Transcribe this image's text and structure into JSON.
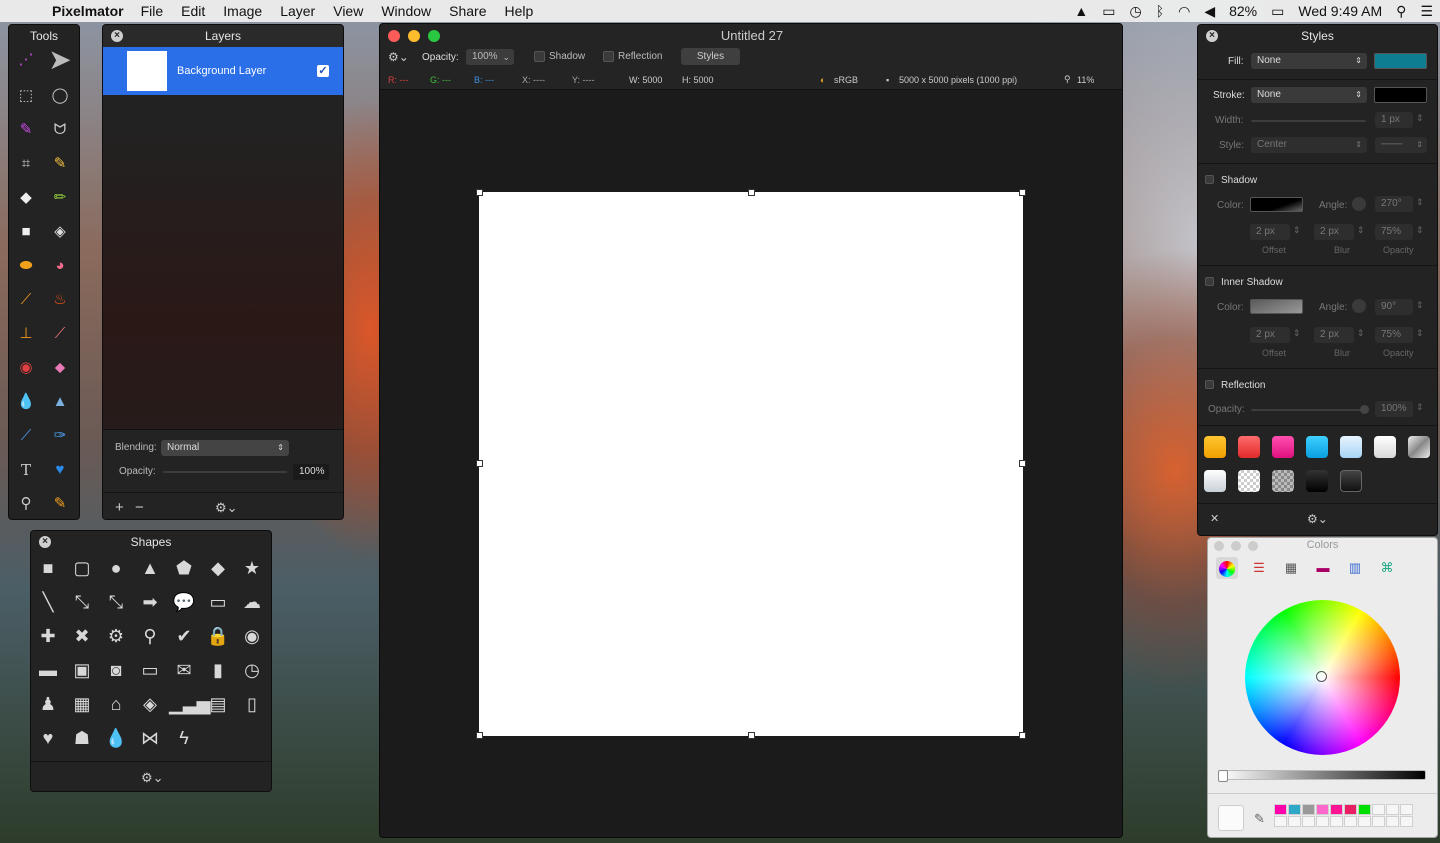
{
  "menubar": {
    "app": "Pixelmator",
    "items": [
      "File",
      "Edit",
      "Image",
      "Layer",
      "View",
      "Window",
      "Share",
      "Help"
    ],
    "battery": "82%",
    "clock": "Wed 9:49 AM"
  },
  "tools": {
    "title": "Tools"
  },
  "layers": {
    "title": "Layers",
    "layer_name": "Background Layer",
    "blending_label": "Blending:",
    "blending_value": "Normal",
    "opacity_label": "Opacity:",
    "opacity_value": "100%",
    "opacity": 1.0,
    "add": "+",
    "remove": "−",
    "gear": "⚙⌄"
  },
  "shapes": {
    "title": "Shapes",
    "gear": "⚙⌄"
  },
  "document": {
    "title": "Untitled 27",
    "opacity_label": "Opacity:",
    "opacity_value": "100%",
    "shadow": "Shadow",
    "reflection": "Reflection",
    "styles": "Styles",
    "info": {
      "r": "R: ---",
      "g": "G: ---",
      "b": "B: ---",
      "x": "X: ----",
      "y": "Y: ----",
      "w": "W: 5000",
      "h": "H: 5000",
      "profile": "sRGB",
      "size": "5000 x 5000 pixels (1000 ppi)",
      "zoom": "11%"
    }
  },
  "styles": {
    "title": "Styles",
    "fill_label": "Fill:",
    "fill_value": "None",
    "fill_color": "#0e7d92",
    "stroke_label": "Stroke:",
    "stroke_value": "None",
    "stroke_color": "#000000",
    "width_label": "Width:",
    "width_value": "1 px",
    "style_label": "Style:",
    "style_value": "Center",
    "shadow": {
      "label": "Shadow",
      "color_label": "Color:",
      "angle_label": "Angle:",
      "angle": "270°",
      "offset": "2 px",
      "blur": "2 px",
      "opacity": "75%",
      "offset_cap": "Offset",
      "blur_cap": "Blur",
      "opacity_cap": "Opacity"
    },
    "inner_shadow": {
      "label": "Inner Shadow",
      "color_label": "Color:",
      "angle_label": "Angle:",
      "angle": "90°",
      "offset": "2 px",
      "blur": "2 px",
      "opacity": "75%",
      "offset_cap": "Offset",
      "blur_cap": "Blur",
      "opacity_cap": "Opacity"
    },
    "reflection": {
      "label": "Reflection",
      "opacity_label": "Opacity:",
      "opacity": "100%"
    },
    "close": "✕",
    "gear": "⚙⌄"
  },
  "colors": {
    "title": "Colors"
  }
}
